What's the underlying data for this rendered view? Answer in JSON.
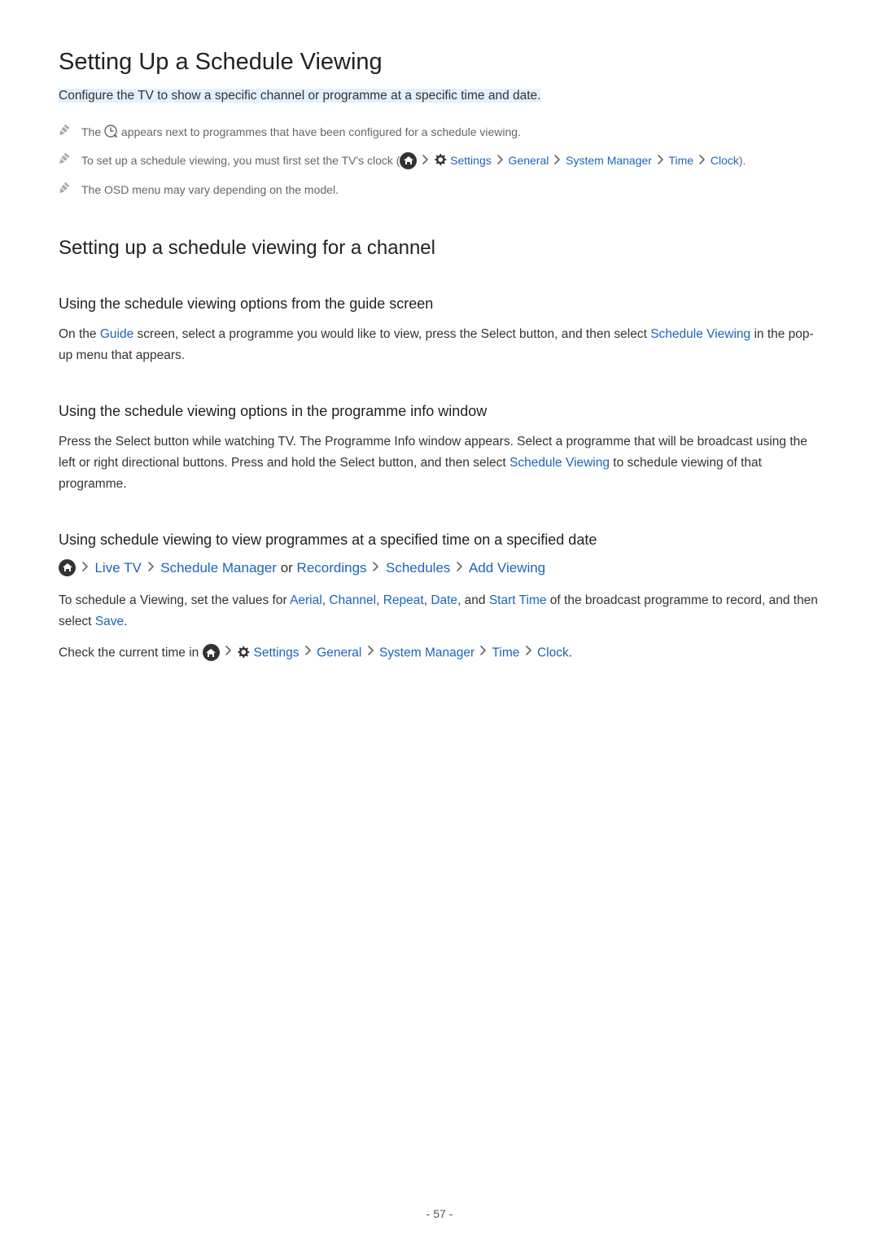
{
  "title": "Setting Up a Schedule Viewing",
  "subtitle": "Configure the TV to show a specific channel or programme at a specific time and date.",
  "notes": {
    "n1_pre": "The ",
    "n1_post": " appears next to programmes that have been configured for a schedule viewing.",
    "n2_pre": "To set up a schedule viewing, you must first set the TV's clock (",
    "n2_settings": "Settings",
    "n2_general": "General",
    "n2_sm": "System Manager",
    "n2_time": "Time",
    "n2_clock": "Clock",
    "n2_close": ").",
    "n3": "The OSD menu may vary depending on the model."
  },
  "h2_1": "Setting up a schedule viewing for a channel",
  "sec1": {
    "h3": "Using the schedule viewing options from the guide screen",
    "p_pre": "On the ",
    "p_guide": "Guide",
    "p_mid": " screen, select a programme you would like to view, press the Select button, and then select ",
    "p_sv": "Schedule Viewing",
    "p_post": " in the pop-up menu that appears."
  },
  "sec2": {
    "h3": "Using the schedule viewing options in the programme info window",
    "p_pre": "Press the Select button while watching TV. The Programme Info window appears. Select a programme that will be broadcast using the left or right directional buttons. Press and hold the Select button, and then select ",
    "p_sv": "Schedule Viewing",
    "p_post": " to schedule viewing of that programme."
  },
  "sec3": {
    "h3": "Using schedule viewing to view programmes at a specified time on a specified date",
    "nav_livetv": "Live TV",
    "nav_sm": "Schedule Manager",
    "nav_or": " or ",
    "nav_rec": "Recordings",
    "nav_sch": "Schedules",
    "nav_add": "Add Viewing",
    "p1_pre": "To schedule a Viewing, set the values for ",
    "p1_aerial": "Aerial",
    "p1_c1": ", ",
    "p1_channel": "Channel",
    "p1_repeat": "Repeat",
    "p1_date": "Date",
    "p1_and": ", and ",
    "p1_start": "Start Time",
    "p1_mid": " of the broadcast programme to record, and then select ",
    "p1_save": "Save",
    "p1_end": ".",
    "p2_pre": "Check the current time in ",
    "p2_settings": "Settings",
    "p2_general": "General",
    "p2_sm": "System Manager",
    "p2_time": "Time",
    "p2_clock": "Clock",
    "p2_end": "."
  },
  "page_number": "- 57 -"
}
